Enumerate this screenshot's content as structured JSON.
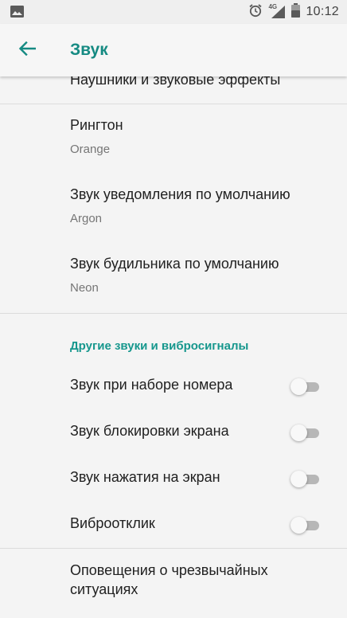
{
  "status_bar": {
    "time": "10:12",
    "network": "4G",
    "icons": [
      "image-icon",
      "alarm-icon",
      "signal-icon",
      "battery-icon"
    ]
  },
  "app_bar": {
    "title": "Звук",
    "back_icon": "arrow-left-icon"
  },
  "settings": {
    "top_item": "Наушники и звуковые эффекты",
    "ringtone": {
      "title": "Рингтон",
      "value": "Orange"
    },
    "notification_sound": {
      "title": "Звук уведомления по умолчанию",
      "value": "Argon"
    },
    "alarm_sound": {
      "title": "Звук будильника по умолчанию",
      "value": "Neon"
    },
    "other_section": {
      "header": "Другие звуки и вибросигналы",
      "toggles": [
        {
          "label": "Звук при наборе номера",
          "enabled": false
        },
        {
          "label": "Звук блокировки экрана",
          "enabled": false
        },
        {
          "label": "Звук нажатия на экран",
          "enabled": false
        },
        {
          "label": "Виброотклик",
          "enabled": false
        }
      ]
    },
    "emergency": {
      "line1": "Оповещения о чрезвычайных",
      "line2": "ситуациях"
    }
  },
  "colors": {
    "accent": "#158a82",
    "section_header": "#16978d",
    "toggle_track_off": "#b7b7b7"
  }
}
